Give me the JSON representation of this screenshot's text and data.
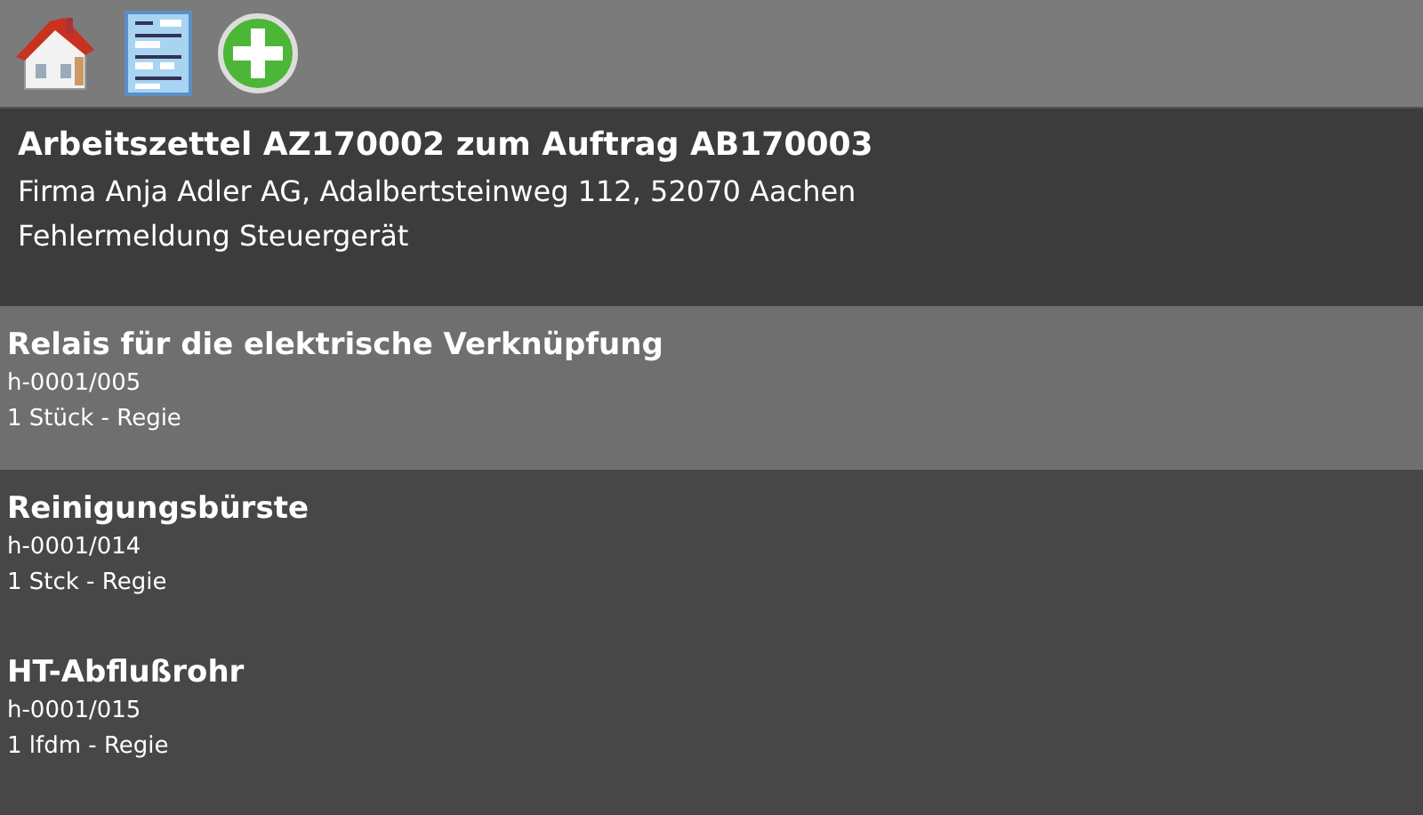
{
  "toolbar": {
    "buttons": [
      {
        "kind": "home"
      },
      {
        "kind": "form"
      },
      {
        "kind": "add"
      }
    ]
  },
  "header": {
    "title": "Arbeitszettel AZ170002 zum Auftrag AB170003",
    "lines": [
      "Firma Anja Adler AG, Adalbertsteinweg 112, 52070 Aachen",
      "Fehlermeldung Steuergerät"
    ]
  },
  "items": [
    {
      "name": "Relais für die elektrische Verknüpfung",
      "number": "h-0001/005",
      "quantity": "1 Stück - Regie",
      "selected": true
    },
    {
      "name": "Reinigungsbürste",
      "number": "h-0001/014",
      "quantity": "1 Stck - Regie",
      "selected": false
    },
    {
      "name": "HT-Abflußrohr",
      "number": "h-0001/015",
      "quantity": "1 lfdm - Regie",
      "selected": false
    }
  ]
}
